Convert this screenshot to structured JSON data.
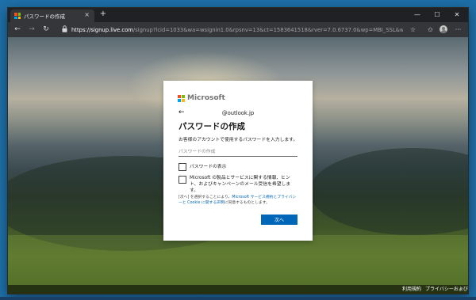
{
  "tab": {
    "title": "パスワードの作成",
    "close": "×",
    "new_tab": "+"
  },
  "window_controls": {
    "minimize": "—",
    "maximize": "☐",
    "close": "✕"
  },
  "toolbar": {
    "back": "←",
    "forward": "→",
    "refresh": "↻",
    "url_host": "https://signup.live.com",
    "url_path": "/signup?lcid=1033&wa=wsignin1.0&rpsnv=13&ct=1583641518&rver=7.0.6737.0&wp=MBI_SSL&wreply=https%3...",
    "star": "☆",
    "favorites": "✩",
    "more": "···"
  },
  "colors": {
    "accent": "#0067b8",
    "ms_red": "#f25022",
    "ms_green": "#7fba00",
    "ms_blue": "#00a4ef",
    "ms_yellow": "#ffb900"
  },
  "card": {
    "brand": "Microsoft",
    "back_arrow": "←",
    "identity": "@outlook.jp",
    "title": "パスワードの作成",
    "description": "お客様のアカウントで使用するパスワードを入力します。",
    "password_placeholder": "パスワードの作成",
    "show_password_label": "パスワードの表示",
    "marketing_label": "Microsoft の製品とサービスに関する情報、ヒント、およびキャンペーンのメール受信を希望します。",
    "legal_prefix": "[次へ] を選択することにより、",
    "legal_link": "Microsoft サービス規約とプライバシーと Cookie に関する声明",
    "legal_suffix": "に同意するものとします。",
    "next_label": "次へ"
  },
  "footer": {
    "terms": "利用規約",
    "privacy": "プライバシーおよびクッキー",
    "more": "···"
  }
}
